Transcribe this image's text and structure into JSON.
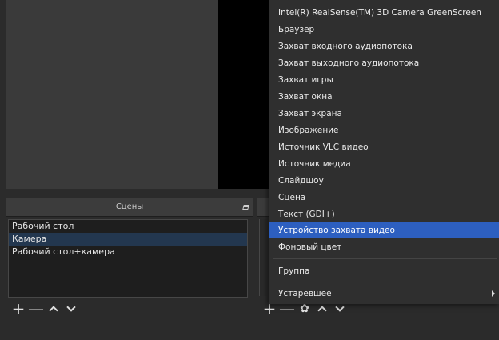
{
  "scenes_dock": {
    "title": "Сцены",
    "items": [
      {
        "label": "Рабочий стол",
        "selected": false
      },
      {
        "label": "Камера",
        "selected": true
      },
      {
        "label": "Рабочий стол+камера",
        "selected": false
      }
    ],
    "toolbar": {
      "add": "+",
      "remove": "—"
    }
  },
  "sources_dock": {
    "toolbar": {
      "add": "+",
      "remove": "—",
      "settings": "✿"
    }
  },
  "context_menu": {
    "items": [
      "Intel(R) RealSense(TM) 3D Camera GreenScreen",
      "Браузер",
      "Захват входного аудиопотока",
      "Захват выходного аудиопотока",
      "Захват игры",
      "Захват окна",
      "Захват экрана",
      "Изображение",
      "Источник VLC видео",
      "Источник медиа",
      "Слайдшоу",
      "Сцена",
      "Текст (GDI+)",
      "Устройство захвата видео",
      "Фоновый цвет"
    ],
    "highlighted": "Устройство захвата видео",
    "group": "Группа",
    "deprecated": "Устаревшее"
  },
  "colors": {
    "background": "#2b2b2b",
    "menu_highlight": "#2d5fc0",
    "list_selection": "#23374f"
  }
}
